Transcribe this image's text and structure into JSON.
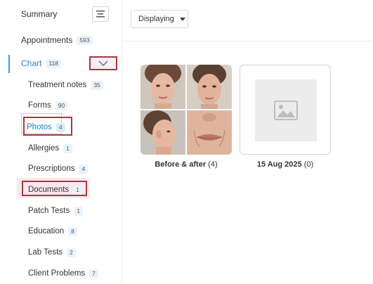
{
  "sidebar": {
    "summary": "Summary",
    "appointments": {
      "label": "Appointments",
      "count": "593"
    },
    "chart": {
      "label": "Chart",
      "count": "118"
    },
    "items": [
      {
        "label": "Treatment notes",
        "count": "35"
      },
      {
        "label": "Forms",
        "count": "90"
      },
      {
        "label": "Photos",
        "count": "4"
      },
      {
        "label": "Allergies",
        "count": "1"
      },
      {
        "label": "Prescriptions",
        "count": "4"
      },
      {
        "label": "Documents",
        "count": "1"
      },
      {
        "label": "Patch Tests",
        "count": "1"
      },
      {
        "label": "Education",
        "count": "8"
      },
      {
        "label": "Lab Tests",
        "count": "2"
      },
      {
        "label": "Client Problems",
        "count": "7"
      }
    ]
  },
  "toolbar": {
    "display_label": "Displaying"
  },
  "albums": [
    {
      "name": "Before & after",
      "count": "(4)"
    },
    {
      "name": "15 Aug 2025",
      "count": "(0)"
    }
  ],
  "colors": {
    "accent": "#3d9bd8",
    "highlight": "#a43c3c",
    "badge_bg": "#e8f3fb"
  }
}
